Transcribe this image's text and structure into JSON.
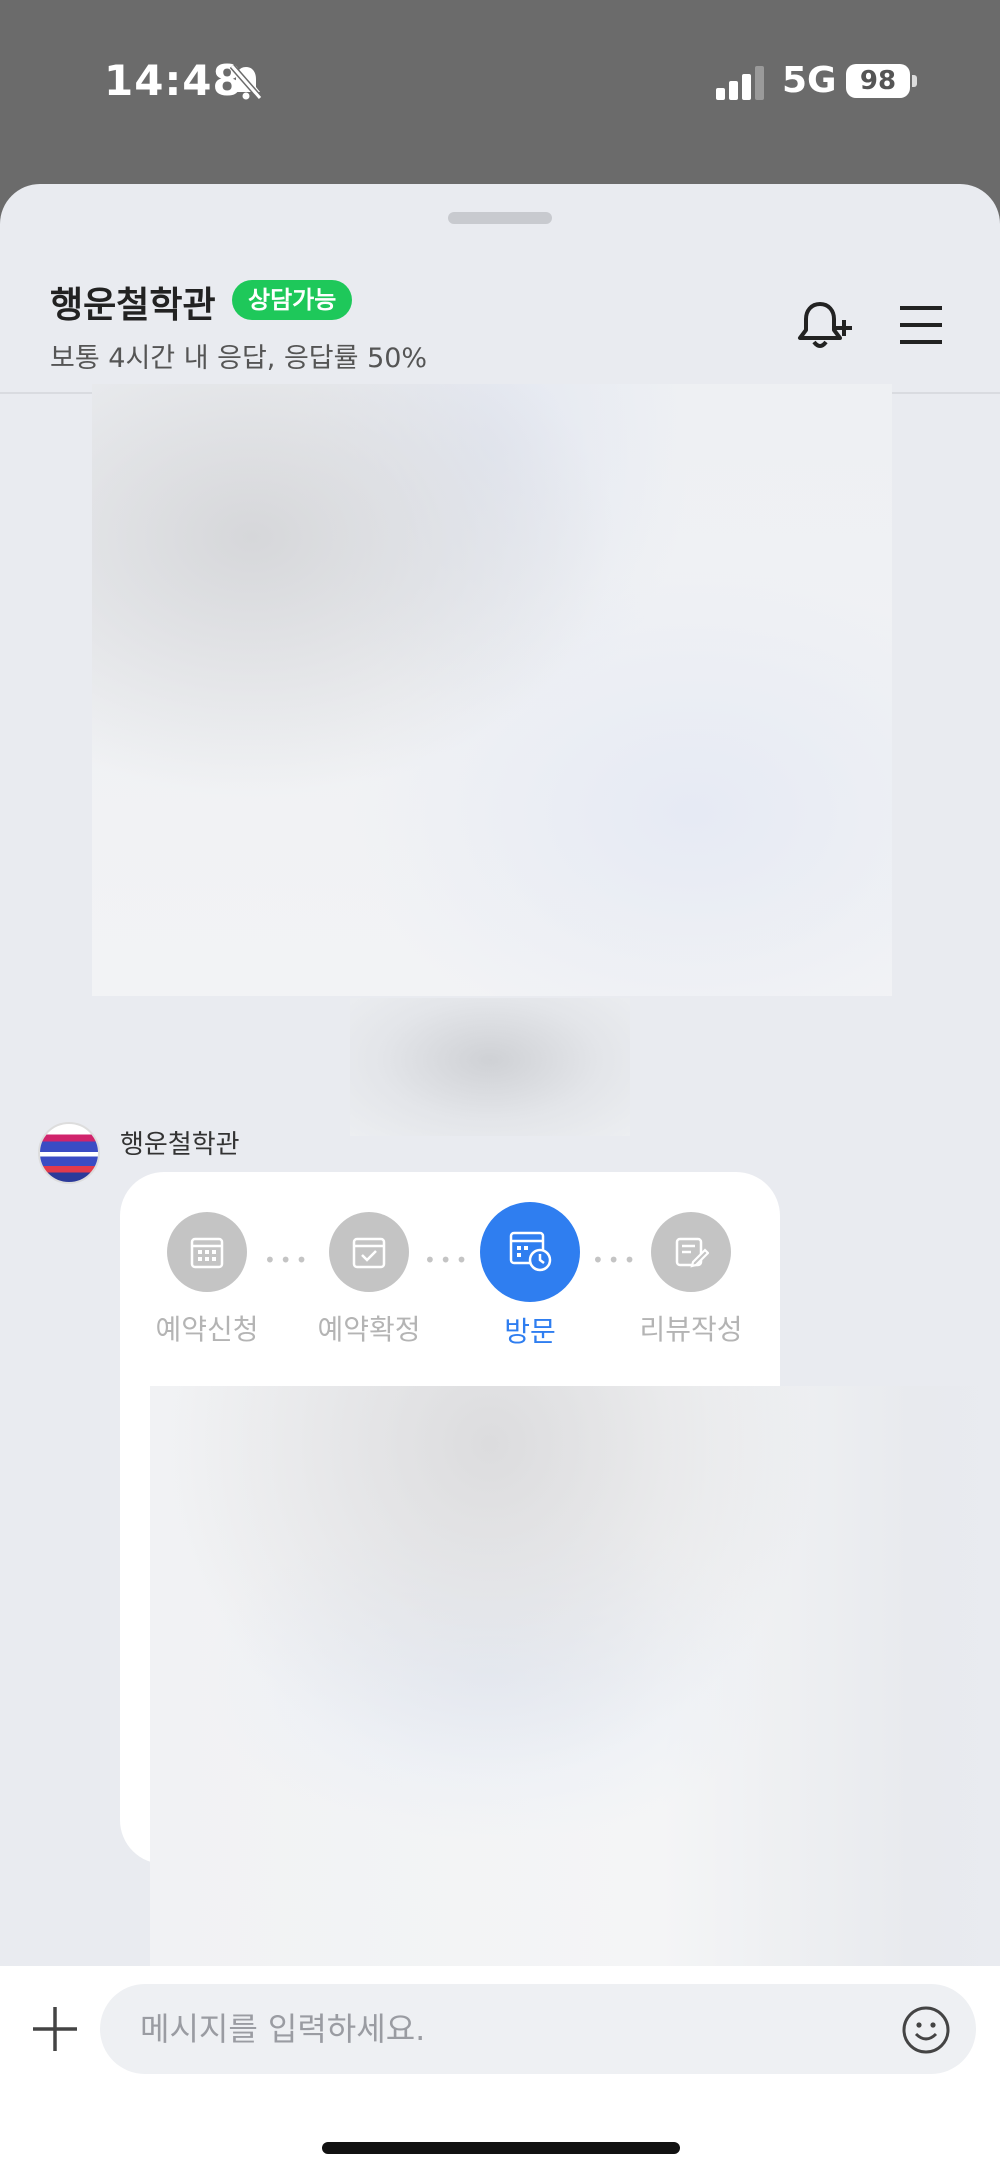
{
  "status_bar": {
    "time": "14:48",
    "network": "5G",
    "battery": "98"
  },
  "header": {
    "title": "행운철학관",
    "badge": "상담가능",
    "subtitle": "보통 4시간 내 응답, 응답률 50%"
  },
  "message": {
    "sender_name": "행운철학관",
    "steps": [
      {
        "label": "예약신청",
        "icon": "calendar-grid-icon",
        "active": false
      },
      {
        "label": "예약확정",
        "icon": "calendar-check-icon",
        "active": false
      },
      {
        "label": "방문",
        "icon": "calendar-clock-icon",
        "active": true
      },
      {
        "label": "리뷰작성",
        "icon": "edit-note-icon",
        "active": false
      }
    ]
  },
  "input": {
    "placeholder": "메시지를 입력하세요."
  },
  "colors": {
    "accent": "#2f7ef0",
    "badge": "#1ec85a",
    "inactive": "#c4c4c4"
  }
}
